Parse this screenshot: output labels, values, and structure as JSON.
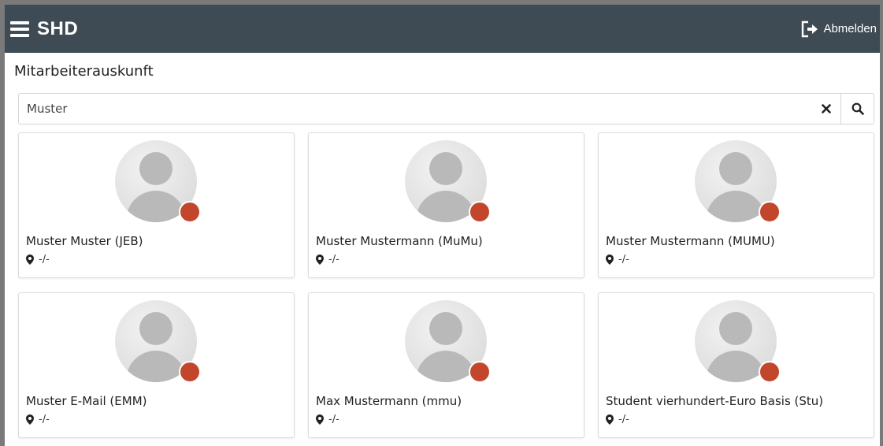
{
  "header": {
    "brand": "SHD",
    "logout_label": "Abmelden"
  },
  "page": {
    "title": "Mitarbeiterauskunft"
  },
  "search": {
    "value": "Muster"
  },
  "icons": {
    "menu": "hamburger-menu-icon",
    "logout": "logout-icon",
    "clear": "close-icon",
    "search": "search-icon",
    "location": "map-marker-icon",
    "avatar": "user-placeholder-icon"
  },
  "colors": {
    "topbar": "#3f4b54",
    "status_absent": "#c2462c"
  },
  "employees": [
    {
      "name": "Muster Muster (JEB)",
      "location": "-/-"
    },
    {
      "name": "Muster Mustermann (MuMu)",
      "location": "-/-"
    },
    {
      "name": "Muster Mustermann (MUMU)",
      "location": "-/-"
    },
    {
      "name": "Muster E-Mail (EMM)",
      "location": "-/-"
    },
    {
      "name": "Max Mustermann (mmu)",
      "location": "-/-"
    },
    {
      "name": "Student vierhundert-Euro Basis (Stu)",
      "location": "-/-"
    }
  ]
}
